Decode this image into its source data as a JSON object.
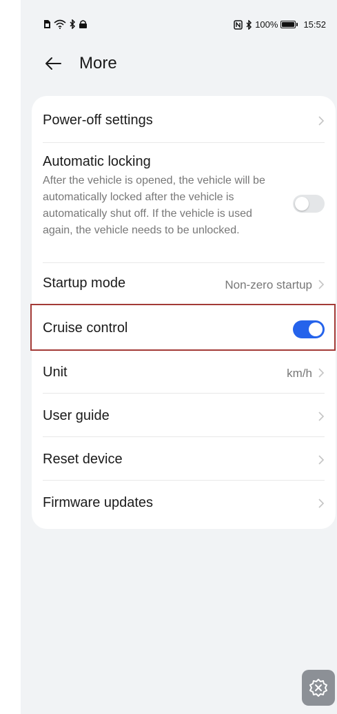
{
  "status_bar": {
    "left_icons": [
      "sim-icon",
      "wifi-icon",
      "bluetooth-status-icon",
      "vpn-icon"
    ],
    "nfc_icon": "nfc-icon",
    "bluetooth_icon": "bluetooth-icon",
    "battery_text": "100%",
    "time": "15:52"
  },
  "header": {
    "title": "More",
    "back_icon": "arrow-left-icon"
  },
  "settings": {
    "power_off": {
      "label": "Power-off settings"
    },
    "auto_lock": {
      "label": "Automatic locking",
      "description": "After the vehicle is opened, the vehicle will be automatically locked after the vehicle is automatically shut off. If the vehicle is used again, the vehicle needs to be unlocked.",
      "enabled": false
    },
    "startup_mode": {
      "label": "Startup mode",
      "value": "Non-zero startup"
    },
    "cruise_control": {
      "label": "Cruise control",
      "enabled": true
    },
    "unit": {
      "label": "Unit",
      "value": "km/h"
    },
    "user_guide": {
      "label": "User guide"
    },
    "reset_device": {
      "label": "Reset device"
    },
    "firmware_updates": {
      "label": "Firmware updates"
    }
  },
  "colors": {
    "accent": "#2563eb",
    "background": "#f1f3f5",
    "card": "#ffffff",
    "highlight_border": "#a33a36",
    "secondary_text": "#777777"
  },
  "floating_button_icon": "settings-icon"
}
